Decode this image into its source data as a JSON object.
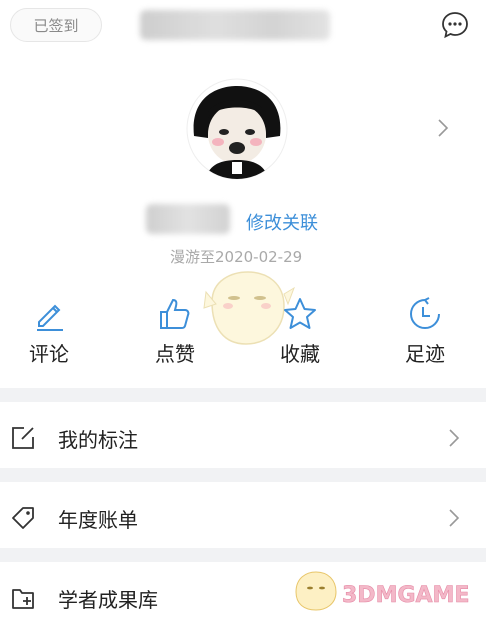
{
  "header": {
    "signed_label": "已签到"
  },
  "profile": {
    "edit_link": "修改关联",
    "roam_text": "漫游至2020-02-29"
  },
  "actions": [
    {
      "label": "评论",
      "icon": "pencil-icon"
    },
    {
      "label": "点赞",
      "icon": "thumbs-up-icon"
    },
    {
      "label": "收藏",
      "icon": "star-icon"
    },
    {
      "label": "足迹",
      "icon": "clock-icon"
    }
  ],
  "menu": [
    {
      "label": "我的标注",
      "icon": "edit-note-icon"
    },
    {
      "label": "年度账单",
      "icon": "tag-icon"
    },
    {
      "label": "学者成果库",
      "icon": "folder-add-icon"
    }
  ],
  "watermark": {
    "brand_text": "3DMGAME"
  },
  "colors": {
    "accent": "#3d8fd9",
    "divider": "#f1f2f4",
    "muted": "#a9a9a9"
  }
}
